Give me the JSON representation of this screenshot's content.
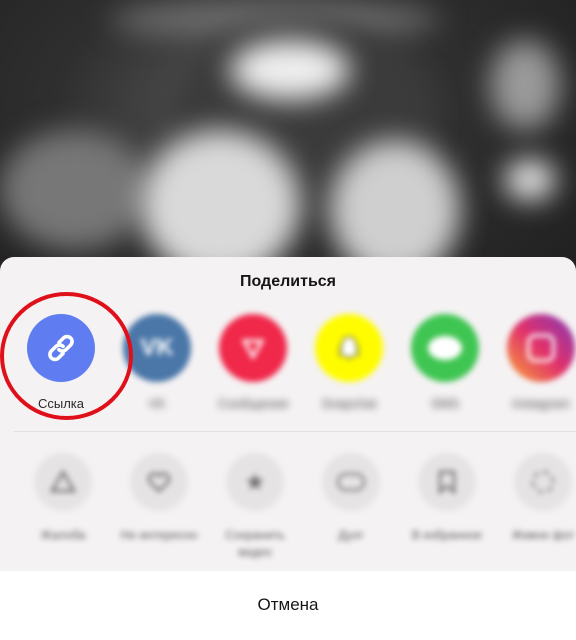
{
  "share_sheet": {
    "title": "Поделиться",
    "share_targets": [
      {
        "label": "Ссылка",
        "icon": "link-icon",
        "color": "#5f7df0"
      },
      {
        "label": "VK",
        "icon": "vk-icon",
        "color": "#4a76a8"
      },
      {
        "label": "Сообщения",
        "icon": "messages-icon",
        "color": "#f0284a"
      },
      {
        "label": "Snapchat",
        "icon": "snapchat-icon",
        "color": "#fffc00"
      },
      {
        "label": "SMS",
        "icon": "sms-icon",
        "color": "#3fc552"
      },
      {
        "label": "Instagram",
        "icon": "instagram-icon",
        "color": "#c13584"
      }
    ],
    "actions": [
      {
        "label": "Жалоба",
        "icon": "warning-icon"
      },
      {
        "label": "Не интересно",
        "icon": "broken-heart-icon"
      },
      {
        "label": "Сохранить видео",
        "icon": "save-star-icon"
      },
      {
        "label": "Дуэт",
        "icon": "duet-icon"
      },
      {
        "label": "В избранное",
        "icon": "bookmark-icon"
      },
      {
        "label": "Живое фот",
        "icon": "live-photo-icon"
      }
    ],
    "cancel_label": "Отмена"
  },
  "highlight": {
    "target": "Ссылка",
    "color": "#e0101a"
  }
}
